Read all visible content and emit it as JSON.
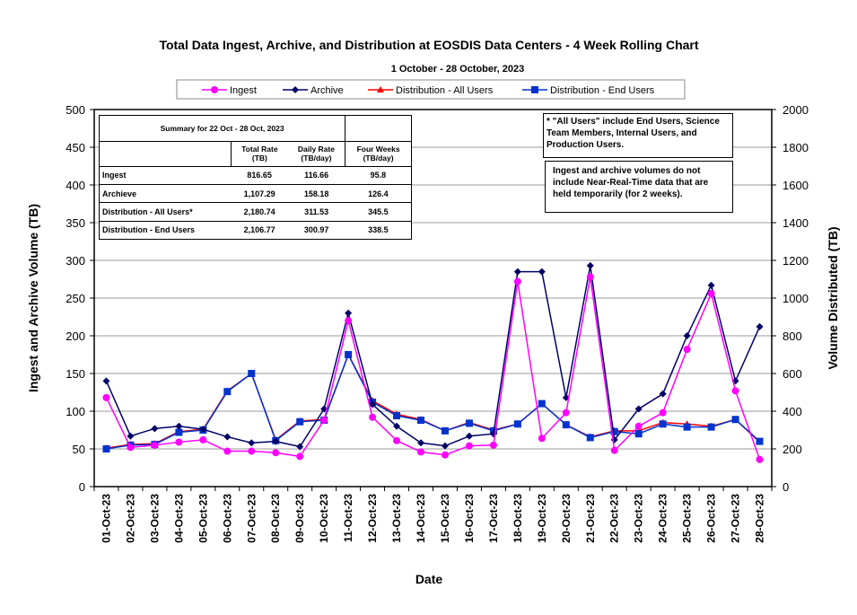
{
  "chart_data": {
    "type": "line",
    "title": "Total Data Ingest, Archive, and  Distribution at EOSDIS Data Centers - 4 Week Rolling Chart",
    "subtitle": "1 October   - 28 October, 2023",
    "xlabel": "Date",
    "ylabel": "Ingest and Archive Volume (TB)",
    "y2label": "Volume Distributed (TB)",
    "ylim": [
      0,
      500
    ],
    "y2lim": [
      0,
      2000
    ],
    "yticks": [
      0,
      50,
      100,
      150,
      200,
      250,
      300,
      350,
      400,
      450,
      500
    ],
    "y2ticks": [
      0,
      200,
      400,
      600,
      800,
      1000,
      1200,
      1400,
      1600,
      1800,
      2000
    ],
    "grid": true,
    "legend_position": "top",
    "categories": [
      "01-Oct-23",
      "02-Oct-23",
      "03-Oct-23",
      "04-Oct-23",
      "05-Oct-23",
      "06-Oct-23",
      "07-Oct-23",
      "08-Oct-23",
      "09-Oct-23",
      "10-Oct-23",
      "11-Oct-23",
      "12-Oct-23",
      "13-Oct-23",
      "14-Oct-23",
      "15-Oct-23",
      "16-Oct-23",
      "17-Oct-23",
      "18-Oct-23",
      "19-Oct-23",
      "20-Oct-23",
      "21-Oct-23",
      "22-Oct-23",
      "23-Oct-23",
      "24-Oct-23",
      "25-Oct-23",
      "26-Oct-23",
      "27-Oct-23",
      "28-Oct-23"
    ],
    "series": [
      {
        "name": "Ingest",
        "axis": "left",
        "color": "#ff00ff",
        "marker": "circle",
        "values": [
          118,
          52,
          55,
          59,
          62,
          47,
          47,
          45,
          40,
          88,
          220,
          92,
          61,
          46,
          42,
          54,
          55,
          272,
          64,
          98,
          278,
          48,
          80,
          98,
          182,
          256,
          127,
          36
        ]
      },
      {
        "name": "Archive",
        "axis": "left",
        "color": "#000066",
        "marker": "diamond",
        "values": [
          140,
          67,
          77,
          80,
          76,
          66,
          58,
          60,
          53,
          103,
          230,
          109,
          80,
          58,
          54,
          67,
          70,
          285,
          285,
          118,
          293,
          62,
          103,
          123,
          200,
          267,
          140,
          212
        ]
      },
      {
        "name": "Distribution - All Users",
        "axis": "right",
        "color": "#ff0000",
        "marker": "triangle",
        "values": [
          204,
          224,
          228,
          292,
          304,
          508,
          600,
          248,
          348,
          356,
          700,
          456,
          384,
          356,
          296,
          340,
          300,
          332,
          440,
          328,
          264,
          296,
          296,
          340,
          332,
          320,
          356,
          236
        ]
      },
      {
        "name": "Distribution - End Users",
        "axis": "right",
        "color": "#0033cc",
        "marker": "square",
        "values": [
          200,
          220,
          224,
          288,
          300,
          504,
          600,
          244,
          344,
          352,
          700,
          448,
          376,
          352,
          296,
          336,
          296,
          332,
          440,
          328,
          260,
          292,
          280,
          332,
          316,
          316,
          356,
          240
        ]
      }
    ]
  },
  "summary": {
    "title": "Summary  for  22  Oct  -  28  Oct,  2023",
    "headers": [
      "Total  Rate\n(TB)",
      "Daily Rate\n(TB/day)",
      "Four Weeks\n(TB/day)"
    ],
    "rows": [
      {
        "label": "Ingest",
        "total": "816.65",
        "daily": "116.66",
        "four": "95.8"
      },
      {
        "label": "Archieve",
        "total": "1,107.29",
        "daily": "158.18",
        "four": "126.4"
      },
      {
        "label": "Distribution - All Users*",
        "total": "2,180.74",
        "daily": "311.53",
        "four": "345.5"
      },
      {
        "label": "Distribution - End Users",
        "total": "2,106.77",
        "daily": "300.97",
        "four": "338.5"
      }
    ]
  },
  "notes": {
    "all_users": "* \"All Users\" include End Users, Science Team Members,  Internal Users, and Production Users.",
    "nrt": "Ingest and archive volumes do not include Near-Real-Time data that are held temporarily (for 2 weeks)."
  }
}
